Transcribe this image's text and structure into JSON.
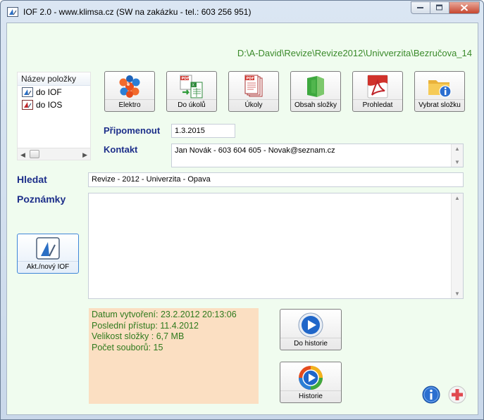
{
  "window": {
    "title": "IOF 2.0 - www.klimsa.cz (SW na zakázku - tel.: 603 256 951)",
    "path": "D:\\A-David\\Revize\\Revize2012\\Univverzita\\Bezručova_14"
  },
  "tree": {
    "header": "Název položky",
    "items": [
      {
        "label": "do IOF",
        "icon": "iof-app-icon"
      },
      {
        "label": "do IOS",
        "icon": "ios-app-icon"
      }
    ]
  },
  "toolbar": {
    "elektro": "Elektro",
    "do_ukolu": "Do úkolů",
    "ukoly": "Úkoly",
    "obsah_slozky": "Obsah složky",
    "prohledat": "Prohledat",
    "vybrat_slozku": "Vybrat složku"
  },
  "form": {
    "pripomenout_label": "Připomenout",
    "pripomenout_value": "1.3.2015",
    "kontakt_label": "Kontakt",
    "kontakt_value": "Jan Novák -  603 604 605 -  Novak@seznam.cz",
    "hledat_label": "Hledat",
    "hledat_value": "Revize -  2012 -  Univerzita -  Opava",
    "poznamky_label": "Poznámky",
    "poznamky_value": ""
  },
  "side_button": {
    "label": "Akt./nový IOF"
  },
  "info": {
    "created": "Datum vytvoření: 23.2.2012 20:13:06",
    "last_access": "Poslední přístup: 11.4.2012",
    "size": "Velikost složky : 6,7 MB",
    "files": "Počet souborů:  15"
  },
  "history_buttons": {
    "do_historie": "Do historie",
    "historie": "Historie"
  },
  "colors": {
    "client_bg": "#f0fcef",
    "path_text": "#3a8a2a",
    "label_text": "#1d2f8a",
    "info_bg": "#fbdfc2",
    "info_text": "#2f7a1d"
  }
}
